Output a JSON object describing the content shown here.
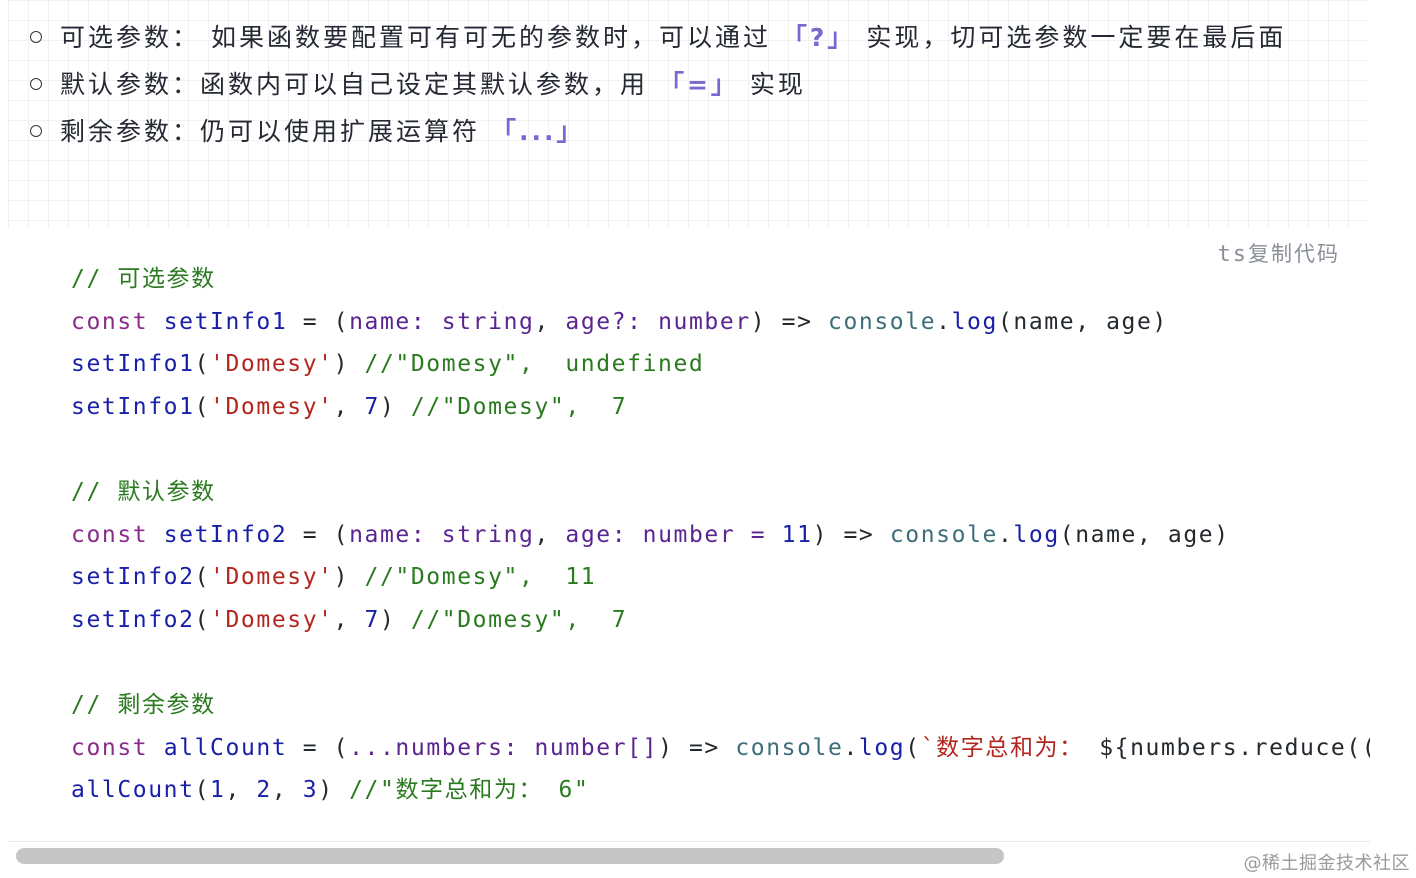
{
  "bullets": [
    {
      "label": "可选参数：",
      "text_before": " 如果函数要配置可有可无的参数时，可以通过 ",
      "highlight": "「?」",
      "text_after": " 实现，切可选参数一定要在最后面"
    },
    {
      "label": "默认参数：",
      "text_before": "函数内可以自己设定其默认参数，用 ",
      "highlight": "「=」",
      "text_after": " 实现"
    },
    {
      "label": "剩余参数：",
      "text_before": "仍可以使用扩展运算符 ",
      "highlight": "「...」",
      "text_after": ""
    }
  ],
  "code_block": {
    "lang": "ts",
    "copy_label": "复制代码",
    "lines": [
      "// 可选参数",
      "const setInfo1 = (name: string, age?: number) => console.log(name, age)",
      "setInfo1('Domesy') //\"Domesy\",  undefined",
      "setInfo1('Domesy', 7) //\"Domesy\",  7",
      "",
      "// 默认参数",
      "const setInfo2 = (name: string, age: number = 11) => console.log(name, age)",
      "setInfo2('Domesy') //\"Domesy\",  11",
      "setInfo2('Domesy', 7) //\"Domesy\",  7",
      "",
      "// 剩余参数",
      "const allCount = (...numbers: number[]) => console.log(`数字总和为： ${numbers.reduce((",
      "allCount(1, 2, 3) //\"数字总和为： 6\""
    ]
  },
  "watermark": "@稀土掘金技术社区",
  "colors": {
    "highlight": "#7c67cf",
    "comment": "#2a7a1f",
    "keyword": "#8a2c8a",
    "function": "#1920a8",
    "string": "#b3261e"
  }
}
